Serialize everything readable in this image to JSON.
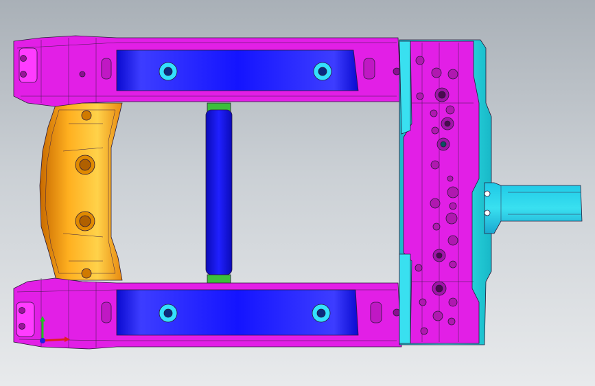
{
  "viewport": {
    "background_top": "#a9b0b7",
    "background_bottom": "#e8eaec"
  },
  "model": {
    "components": [
      {
        "name": "front-cross-member",
        "color": "#e21fe6"
      },
      {
        "name": "rear-cross-member",
        "color": "#e21fe6"
      },
      {
        "name": "right-side-rail",
        "color": "#e21fe6"
      },
      {
        "name": "left-bracket",
        "color": "#ff9a10"
      },
      {
        "name": "cross-tube",
        "color": "#1a1aff"
      },
      {
        "name": "tube-end-caps",
        "color": "#3cbf3c"
      },
      {
        "name": "reinforcement-plates",
        "color": "#1a1aff"
      },
      {
        "name": "outer-trim",
        "color": "#22e6e6"
      },
      {
        "name": "mounting-arm",
        "color": "#22d8e6"
      }
    ]
  },
  "triad": {
    "icon": "axis-triad-icon",
    "x_color": "#e02020",
    "y_color": "#20c020",
    "z_color": "#2020e0"
  }
}
